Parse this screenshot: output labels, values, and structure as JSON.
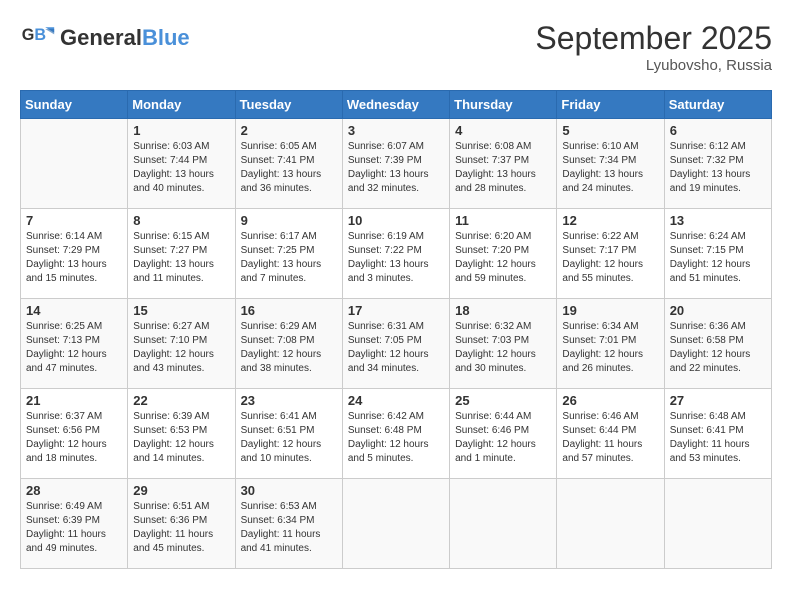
{
  "logo": {
    "line1": "General",
    "line2": "Blue"
  },
  "title": "September 2025",
  "location": "Lyubovsho, Russia",
  "days_of_week": [
    "Sunday",
    "Monday",
    "Tuesday",
    "Wednesday",
    "Thursday",
    "Friday",
    "Saturday"
  ],
  "weeks": [
    [
      {
        "day": "",
        "info": ""
      },
      {
        "day": "1",
        "info": "Sunrise: 6:03 AM\nSunset: 7:44 PM\nDaylight: 13 hours\nand 40 minutes."
      },
      {
        "day": "2",
        "info": "Sunrise: 6:05 AM\nSunset: 7:41 PM\nDaylight: 13 hours\nand 36 minutes."
      },
      {
        "day": "3",
        "info": "Sunrise: 6:07 AM\nSunset: 7:39 PM\nDaylight: 13 hours\nand 32 minutes."
      },
      {
        "day": "4",
        "info": "Sunrise: 6:08 AM\nSunset: 7:37 PM\nDaylight: 13 hours\nand 28 minutes."
      },
      {
        "day": "5",
        "info": "Sunrise: 6:10 AM\nSunset: 7:34 PM\nDaylight: 13 hours\nand 24 minutes."
      },
      {
        "day": "6",
        "info": "Sunrise: 6:12 AM\nSunset: 7:32 PM\nDaylight: 13 hours\nand 19 minutes."
      }
    ],
    [
      {
        "day": "7",
        "info": "Sunrise: 6:14 AM\nSunset: 7:29 PM\nDaylight: 13 hours\nand 15 minutes."
      },
      {
        "day": "8",
        "info": "Sunrise: 6:15 AM\nSunset: 7:27 PM\nDaylight: 13 hours\nand 11 minutes."
      },
      {
        "day": "9",
        "info": "Sunrise: 6:17 AM\nSunset: 7:25 PM\nDaylight: 13 hours\nand 7 minutes."
      },
      {
        "day": "10",
        "info": "Sunrise: 6:19 AM\nSunset: 7:22 PM\nDaylight: 13 hours\nand 3 minutes."
      },
      {
        "day": "11",
        "info": "Sunrise: 6:20 AM\nSunset: 7:20 PM\nDaylight: 12 hours\nand 59 minutes."
      },
      {
        "day": "12",
        "info": "Sunrise: 6:22 AM\nSunset: 7:17 PM\nDaylight: 12 hours\nand 55 minutes."
      },
      {
        "day": "13",
        "info": "Sunrise: 6:24 AM\nSunset: 7:15 PM\nDaylight: 12 hours\nand 51 minutes."
      }
    ],
    [
      {
        "day": "14",
        "info": "Sunrise: 6:25 AM\nSunset: 7:13 PM\nDaylight: 12 hours\nand 47 minutes."
      },
      {
        "day": "15",
        "info": "Sunrise: 6:27 AM\nSunset: 7:10 PM\nDaylight: 12 hours\nand 43 minutes."
      },
      {
        "day": "16",
        "info": "Sunrise: 6:29 AM\nSunset: 7:08 PM\nDaylight: 12 hours\nand 38 minutes."
      },
      {
        "day": "17",
        "info": "Sunrise: 6:31 AM\nSunset: 7:05 PM\nDaylight: 12 hours\nand 34 minutes."
      },
      {
        "day": "18",
        "info": "Sunrise: 6:32 AM\nSunset: 7:03 PM\nDaylight: 12 hours\nand 30 minutes."
      },
      {
        "day": "19",
        "info": "Sunrise: 6:34 AM\nSunset: 7:01 PM\nDaylight: 12 hours\nand 26 minutes."
      },
      {
        "day": "20",
        "info": "Sunrise: 6:36 AM\nSunset: 6:58 PM\nDaylight: 12 hours\nand 22 minutes."
      }
    ],
    [
      {
        "day": "21",
        "info": "Sunrise: 6:37 AM\nSunset: 6:56 PM\nDaylight: 12 hours\nand 18 minutes."
      },
      {
        "day": "22",
        "info": "Sunrise: 6:39 AM\nSunset: 6:53 PM\nDaylight: 12 hours\nand 14 minutes."
      },
      {
        "day": "23",
        "info": "Sunrise: 6:41 AM\nSunset: 6:51 PM\nDaylight: 12 hours\nand 10 minutes."
      },
      {
        "day": "24",
        "info": "Sunrise: 6:42 AM\nSunset: 6:48 PM\nDaylight: 12 hours\nand 5 minutes."
      },
      {
        "day": "25",
        "info": "Sunrise: 6:44 AM\nSunset: 6:46 PM\nDaylight: 12 hours\nand 1 minute."
      },
      {
        "day": "26",
        "info": "Sunrise: 6:46 AM\nSunset: 6:44 PM\nDaylight: 11 hours\nand 57 minutes."
      },
      {
        "day": "27",
        "info": "Sunrise: 6:48 AM\nSunset: 6:41 PM\nDaylight: 11 hours\nand 53 minutes."
      }
    ],
    [
      {
        "day": "28",
        "info": "Sunrise: 6:49 AM\nSunset: 6:39 PM\nDaylight: 11 hours\nand 49 minutes."
      },
      {
        "day": "29",
        "info": "Sunrise: 6:51 AM\nSunset: 6:36 PM\nDaylight: 11 hours\nand 45 minutes."
      },
      {
        "day": "30",
        "info": "Sunrise: 6:53 AM\nSunset: 6:34 PM\nDaylight: 11 hours\nand 41 minutes."
      },
      {
        "day": "",
        "info": ""
      },
      {
        "day": "",
        "info": ""
      },
      {
        "day": "",
        "info": ""
      },
      {
        "day": "",
        "info": ""
      }
    ]
  ]
}
